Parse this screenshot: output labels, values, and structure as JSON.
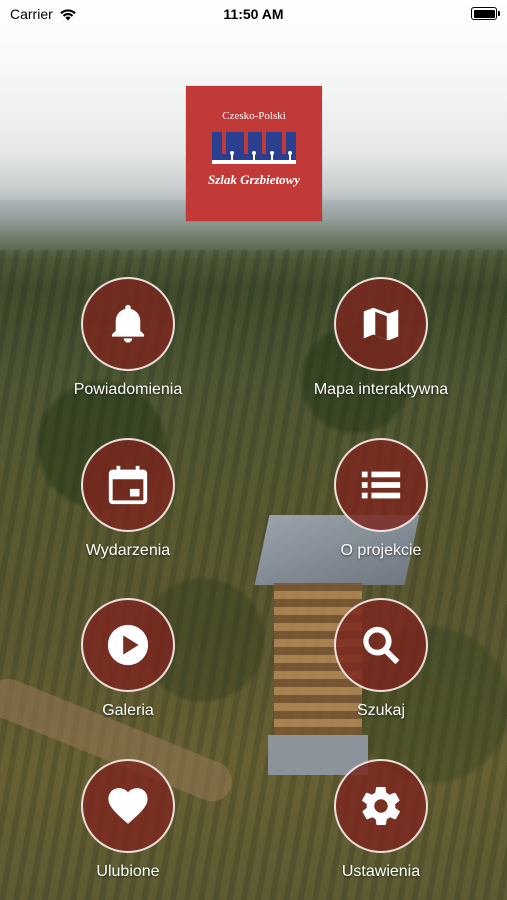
{
  "status_bar": {
    "carrier": "Carrier",
    "time": "11:50 AM",
    "wifi_icon": "wifi-icon",
    "battery_icon": "battery-icon"
  },
  "logo": {
    "top_text": "Czesko-Polski",
    "bottom_text": "Szlak Grzbietowy",
    "color": "#c23a37",
    "graphic_color": "#2a3f8f"
  },
  "menu": [
    {
      "label": "Powiadomienia",
      "icon": "bell-icon"
    },
    {
      "label": "Mapa interaktywna",
      "icon": "map-icon"
    },
    {
      "label": "Wydarzenia",
      "icon": "calendar-icon"
    },
    {
      "label": "O projekcie",
      "icon": "list-icon"
    },
    {
      "label": "Galeria",
      "icon": "play-icon"
    },
    {
      "label": "Szukaj",
      "icon": "search-icon"
    },
    {
      "label": "Ulubione",
      "icon": "heart-icon"
    },
    {
      "label": "Ustawienia",
      "icon": "gear-icon"
    }
  ],
  "colors": {
    "circle_fill": "#7d261e",
    "circle_border": "#ffffff",
    "label": "#ffffff"
  }
}
